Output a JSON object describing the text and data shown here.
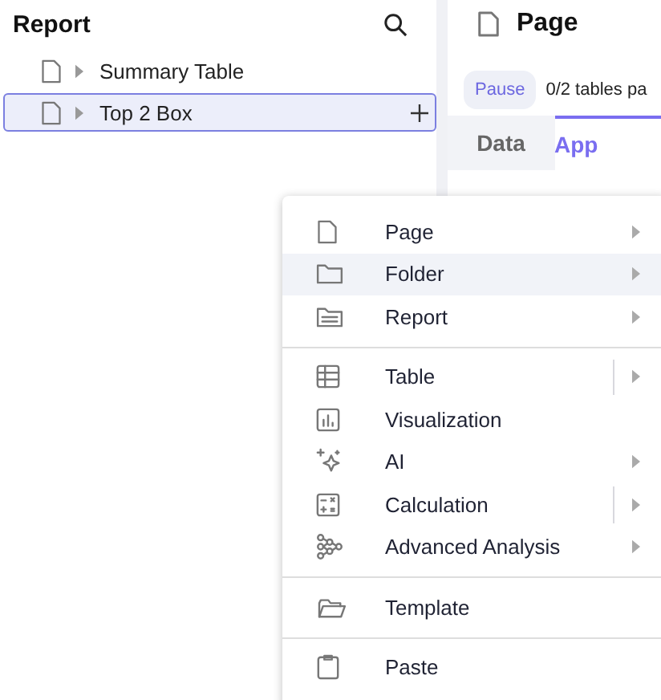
{
  "sidebar": {
    "title": "Report",
    "items": [
      {
        "label": "Summary Table",
        "expanded": false,
        "selected": false
      },
      {
        "label": "Top 2 Box",
        "expanded": false,
        "selected": true
      }
    ]
  },
  "panel": {
    "title": "Page",
    "pause_button": "Pause",
    "status": "0/2 tables pa",
    "tabs": [
      {
        "label": "Data",
        "selected": false
      },
      {
        "label": "App",
        "selected": true
      }
    ]
  },
  "context_menu": {
    "sections": [
      [
        {
          "kind": "page",
          "label": "Page",
          "submenu": true,
          "split": false,
          "highlighted": false
        },
        {
          "kind": "folder",
          "label": "Folder",
          "submenu": true,
          "split": false,
          "highlighted": true
        },
        {
          "kind": "report",
          "label": "Report",
          "submenu": true,
          "split": false,
          "highlighted": false
        }
      ],
      [
        {
          "kind": "table",
          "label": "Table",
          "submenu": true,
          "split": true,
          "highlighted": false
        },
        {
          "kind": "visualization",
          "label": "Visualization",
          "submenu": false,
          "split": false,
          "highlighted": false
        },
        {
          "kind": "ai",
          "label": "AI",
          "submenu": true,
          "split": false,
          "highlighted": false
        },
        {
          "kind": "calculation",
          "label": "Calculation",
          "submenu": true,
          "split": true,
          "highlighted": false
        },
        {
          "kind": "analysis",
          "label": "Advanced Analysis",
          "submenu": true,
          "split": false,
          "highlighted": false
        }
      ],
      [
        {
          "kind": "template",
          "label": "Template",
          "submenu": false,
          "split": false,
          "highlighted": false
        }
      ],
      [
        {
          "kind": "paste",
          "label": "Paste",
          "submenu": false,
          "split": false,
          "highlighted": false
        }
      ]
    ]
  }
}
